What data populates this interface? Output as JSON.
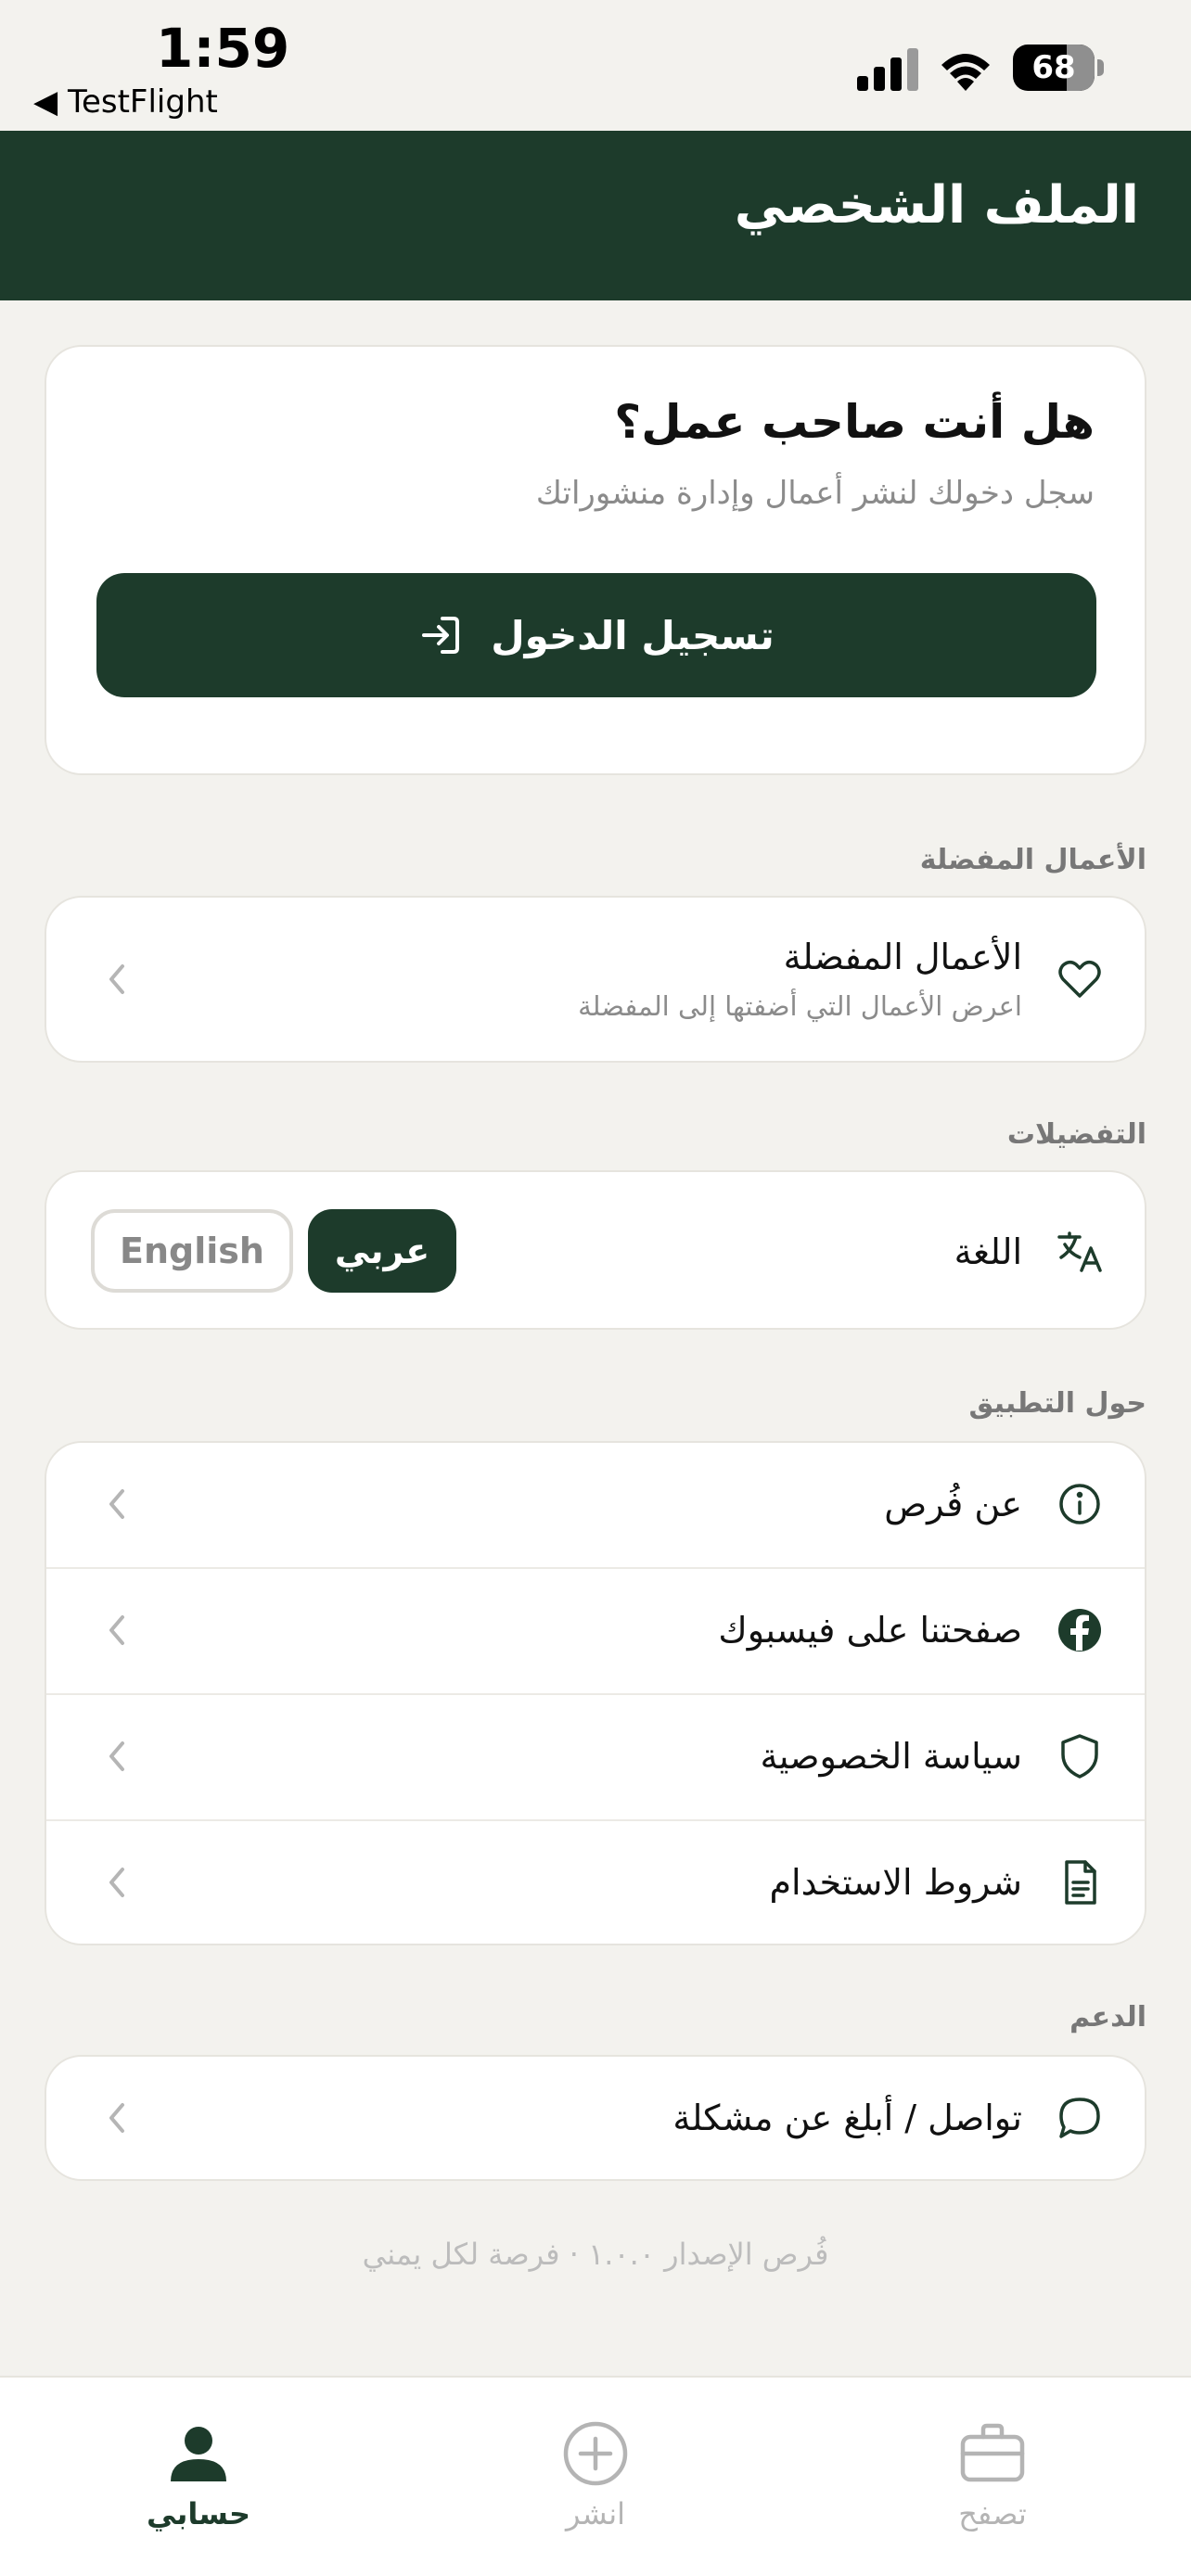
{
  "status_bar": {
    "time": "1:59",
    "back_app": "◀ TestFlight",
    "battery": "68"
  },
  "header": {
    "title": "الملف الشخصي"
  },
  "login_card": {
    "title": "هل أنت صاحب عمل؟",
    "subtitle": "سجل دخولك لنشر أعمال وإدارة منشوراتك",
    "button_label": "تسجيل الدخول"
  },
  "favorites": {
    "section_label": "الأعمال المفضلة",
    "item_title": "الأعمال المفضلة",
    "item_subtitle": "اعرض الأعمال التي أضفتها إلى المفضلة"
  },
  "preferences": {
    "section_label": "التفضيلات",
    "language_label": "اللغة",
    "lang_arabic": "عربي",
    "lang_english": "English",
    "selected": "عربي"
  },
  "about": {
    "section_label": "حول التطبيق",
    "items": [
      {
        "label": "عن فُرص",
        "icon": "info-icon"
      },
      {
        "label": "صفحتنا على فيسبوك",
        "icon": "facebook-icon"
      },
      {
        "label": "سياسة الخصوصية",
        "icon": "shield-icon"
      },
      {
        "label": "شروط الاستخدام",
        "icon": "document-icon"
      }
    ]
  },
  "support": {
    "section_label": "الدعم",
    "item": "تواصل / أبلغ عن مشكلة"
  },
  "version_text": "فُرص الإصدار ١.٠.٠ · فرصة لكل يمني",
  "tab_bar": {
    "tabs": [
      {
        "label": "حسابي",
        "icon": "person-icon",
        "active": true
      },
      {
        "label": "انشر",
        "icon": "plus-circle-icon",
        "active": false
      },
      {
        "label": "تصفح",
        "icon": "briefcase-icon",
        "active": false
      }
    ]
  },
  "colors": {
    "primary": "#1D3B2B",
    "background": "#F3F2EE",
    "card": "#FFFFFF",
    "muted": "#8B8B8B"
  }
}
